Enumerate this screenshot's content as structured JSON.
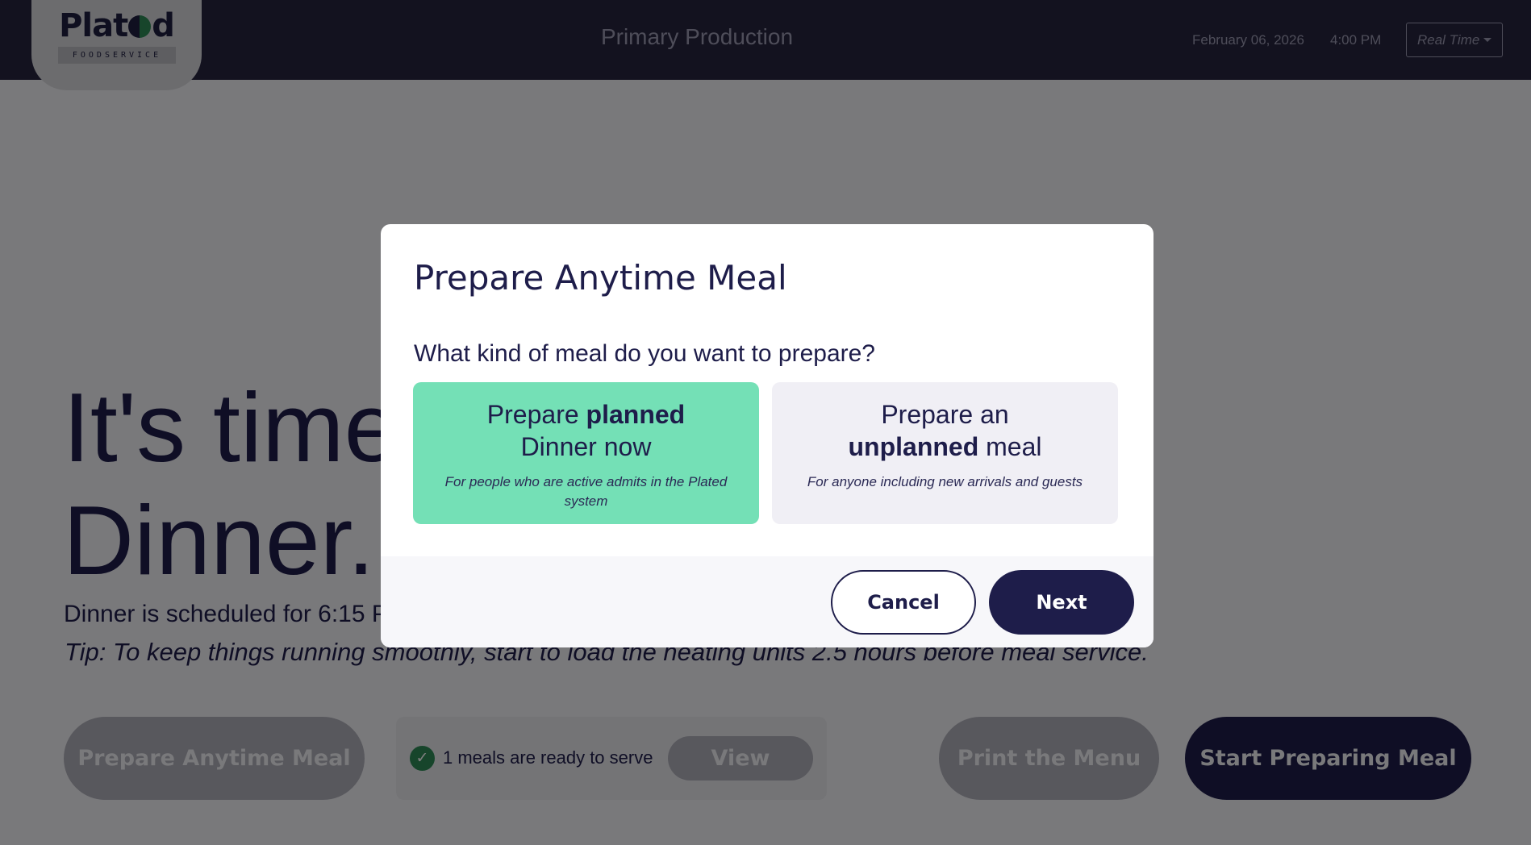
{
  "header": {
    "logo_word_left": "Plat",
    "logo_word_right": "d",
    "logo_sub": "FOODSERVICE",
    "title": "Primary Production",
    "date": "February 06, 2026",
    "time": "4:00 PM",
    "mode_select": "Real Time"
  },
  "main": {
    "hero_line1": "It's time",
    "hero_line2": "Dinner.",
    "schedule": "Dinner is scheduled for 6:15 P",
    "tip": "Tip: To keep things running smoothly, start to load the heating units 2.5 hours before meal service.",
    "prepare_anytime_label": "Prepare Anytime Meal",
    "ready_text": "1 meals are ready to serve",
    "view_label": "View",
    "print_label": "Print the Menu",
    "start_label": "Start Preparing Meal"
  },
  "modal": {
    "title": "Prepare Anytime Meal",
    "question": "What kind of meal do you want to prepare?",
    "planned": {
      "prefix": "Prepare ",
      "bold": "planned",
      "line2": "Dinner now",
      "sub": "For people who are active admits in the Plated system"
    },
    "unplanned": {
      "line1": "Prepare an",
      "bold": "unplanned",
      "suffix": " meal",
      "sub": "For anyone including new arrivals and guests"
    },
    "cancel_label": "Cancel",
    "next_label": "Next"
  },
  "colors": {
    "header_bg": "#26253f",
    "navy": "#1e1d4a",
    "planned_option": "#74e0b6",
    "unplanned_option": "#f0eff5",
    "check_green": "#2e8b57"
  },
  "icons": {
    "ready": "check-circle-icon",
    "select": "caret-down-icon"
  }
}
